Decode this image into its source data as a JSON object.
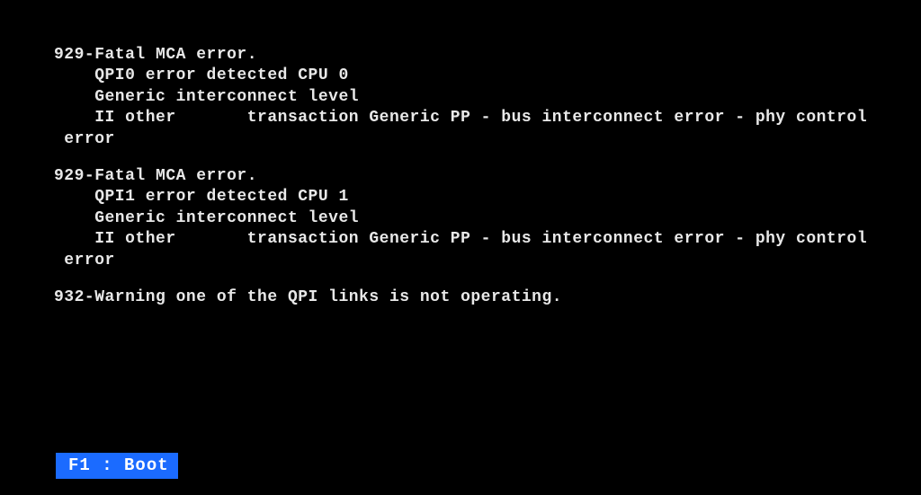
{
  "errors": [
    {
      "header": "929-Fatal MCA error.",
      "lines": [
        "    QPI0 error detected CPU 0",
        "    Generic interconnect level",
        "    II other       transaction Generic PP - bus interconnect error - phy control",
        " error"
      ]
    },
    {
      "header": "929-Fatal MCA error.",
      "lines": [
        "    QPI1 error detected CPU 1",
        "    Generic interconnect level",
        "    II other       transaction Generic PP - bus interconnect error - phy control",
        " error"
      ]
    }
  ],
  "warning": "932-Warning one of the QPI links is not operating.",
  "boot_hint": "F1 : Boot"
}
